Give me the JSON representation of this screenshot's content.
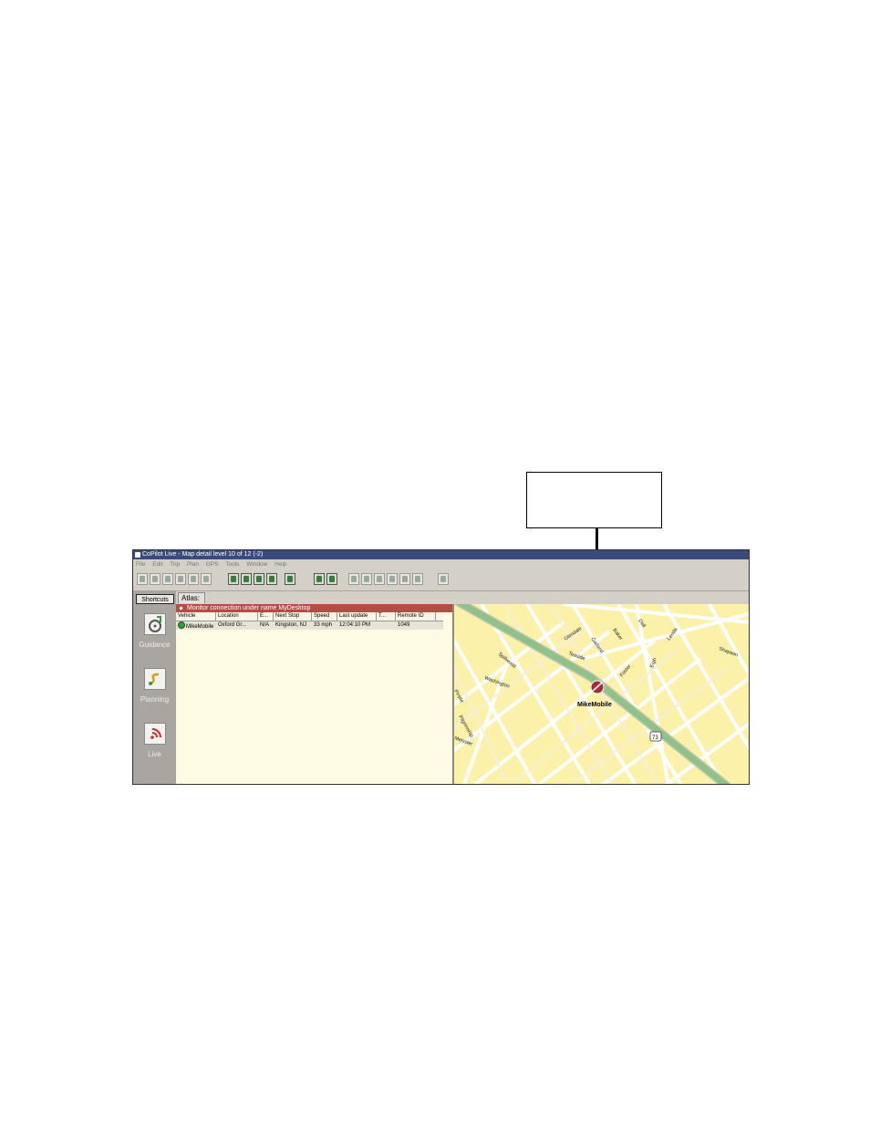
{
  "window": {
    "title": "CoPilot Live - Map detail level 10 of 12 (-2)"
  },
  "menu": [
    "File",
    "Edit",
    "Trip",
    "Plan",
    "GPS",
    "Tools",
    "Window",
    "Help"
  ],
  "sidebar": {
    "shortcuts_label": "Shortcuts",
    "items": [
      {
        "label": "Guidance",
        "icon": "steering-wheel-icon"
      },
      {
        "label": "Planning",
        "icon": "route-planning-icon"
      },
      {
        "label": "Live",
        "icon": "signal-icon"
      }
    ]
  },
  "tab": {
    "label": "Atlas:"
  },
  "monitor": {
    "header": "Monitor connection under name MyDesktop",
    "columns": [
      "Vehicle",
      "Location",
      "E...",
      "Next Stop",
      "Speed",
      "Last update",
      "T...",
      "Remote ID"
    ],
    "rows": [
      [
        "MikeMobile",
        "Oxford Gr...",
        "N/A",
        "Kingston, NJ",
        "33 mph",
        "12:04:10 PM",
        "",
        "1049"
      ]
    ]
  },
  "map": {
    "vehicle_label": "MikeMobile",
    "route_shield": "73",
    "street_labels": [
      "Glendale",
      "Garland",
      "Baker",
      "Dell",
      "Teaside",
      "Foster",
      "Eigh",
      "Leoda",
      "Shapson",
      "Spillwood",
      "Washington",
      "Pilgrimship",
      "Pirstle",
      "Meisster"
    ]
  },
  "colors": {
    "map_bg": "#fbf1a8",
    "road": "#ffffff",
    "highway": "#8fc28a",
    "header": "#b84c44"
  }
}
